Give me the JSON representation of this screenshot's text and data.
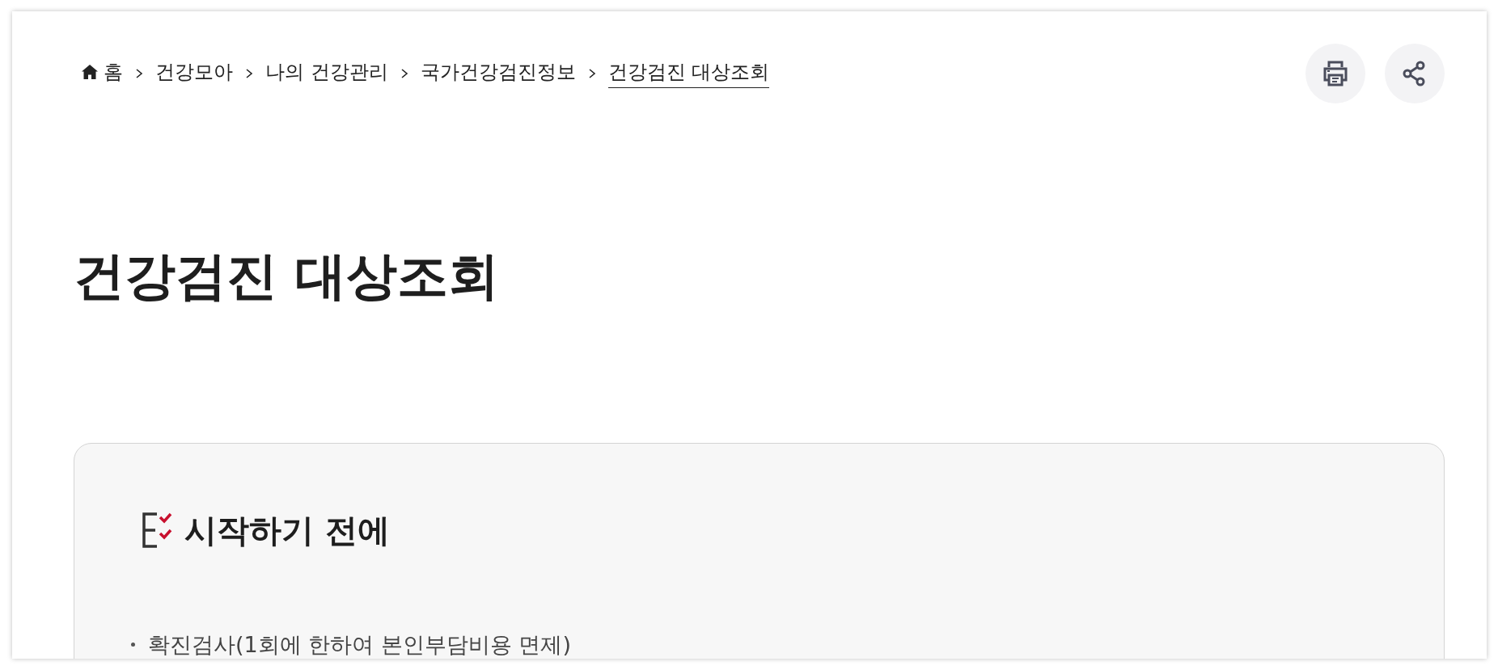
{
  "breadcrumb": [
    {
      "label": "홈",
      "kind": "home",
      "current": false
    },
    {
      "label": "건강모아",
      "kind": "link",
      "current": false
    },
    {
      "label": "나의 건강관리",
      "kind": "link",
      "current": false
    },
    {
      "label": "국가건강검진정보",
      "kind": "link",
      "current": false
    },
    {
      "label": "건강검진 대상조회",
      "kind": "link",
      "current": true
    }
  ],
  "actions": [
    {
      "kind": "print"
    },
    {
      "kind": "share"
    }
  ],
  "title": "건강검진 대상조회",
  "notice": {
    "heading": "시작하기 전에",
    "items": [
      "확진검사(1회에 한하여 본인부담비용 면제)"
    ]
  }
}
